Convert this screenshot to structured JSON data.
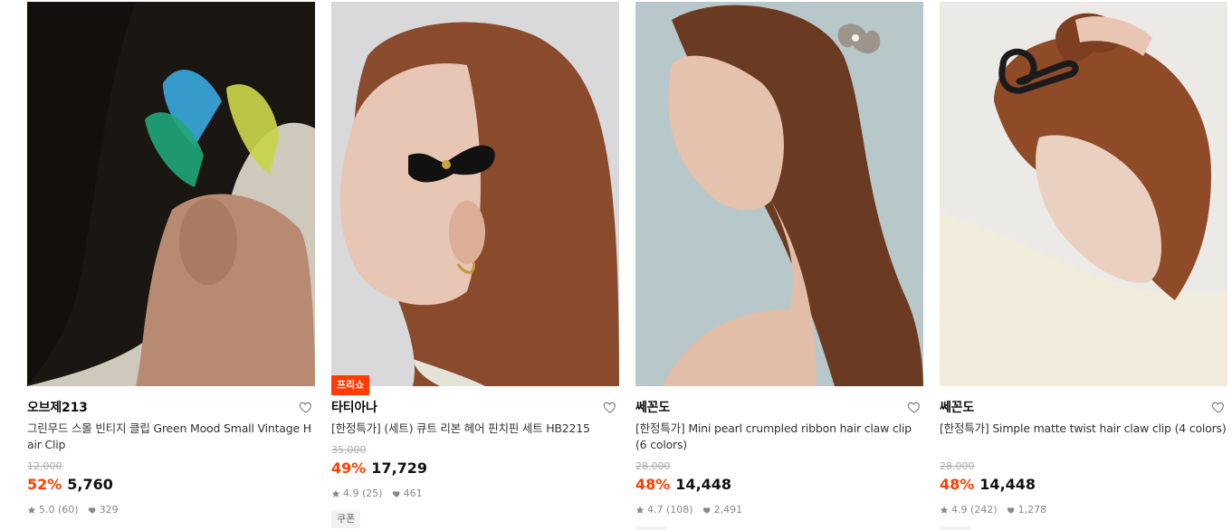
{
  "products": [
    {
      "brand": "오브제213",
      "title": "그린무드 스몰 빈티지 클립 Green Mood Small Vintage Hair Clip",
      "original_price": "12,000",
      "discount": "52%",
      "price": "5,760",
      "rating": "5.0",
      "review_count": "(60)",
      "likes": "329",
      "image": "woman-dark-hair-colorful-snap-clips"
    },
    {
      "badge": "프리쇼",
      "brand": "타티아나",
      "title": "[한정특가] (세트) 큐트 리본 헤어 핀치핀 세트 HB2215",
      "original_price": "35,000",
      "discount": "49%",
      "price": "17,729",
      "rating": "4.9",
      "review_count": "(25)",
      "likes": "461",
      "coupon": "쿠폰",
      "image": "woman-red-hair-black-velvet-bow-clip"
    },
    {
      "brand": "쎄꼰도",
      "title": "[한정특가] Mini pearl crumpled ribbon hair claw clip (6 colors)",
      "original_price": "28,000",
      "discount": "48%",
      "price": "14,448",
      "rating": "4.7",
      "review_count": "(108)",
      "likes": "2,491",
      "image": "woman-half-up-hair-pearl-ribbon-claw"
    },
    {
      "brand": "쎄꼰도",
      "title": "[한정특가] Simple matte twist hair claw clip (4 colors)",
      "original_price": "28,000",
      "discount": "48%",
      "price": "14,448",
      "rating": "4.9",
      "review_count": "(242)",
      "likes": "1,278",
      "image": "woman-updo-black-twist-claw-clip"
    }
  ],
  "colors": {
    "discount": "#ff3d00",
    "badge": "#ff3d00",
    "muted": "#888888"
  },
  "icons": {
    "wishlist": "heart-outline-icon",
    "rating": "star-icon",
    "likes": "heart-filled-icon"
  }
}
